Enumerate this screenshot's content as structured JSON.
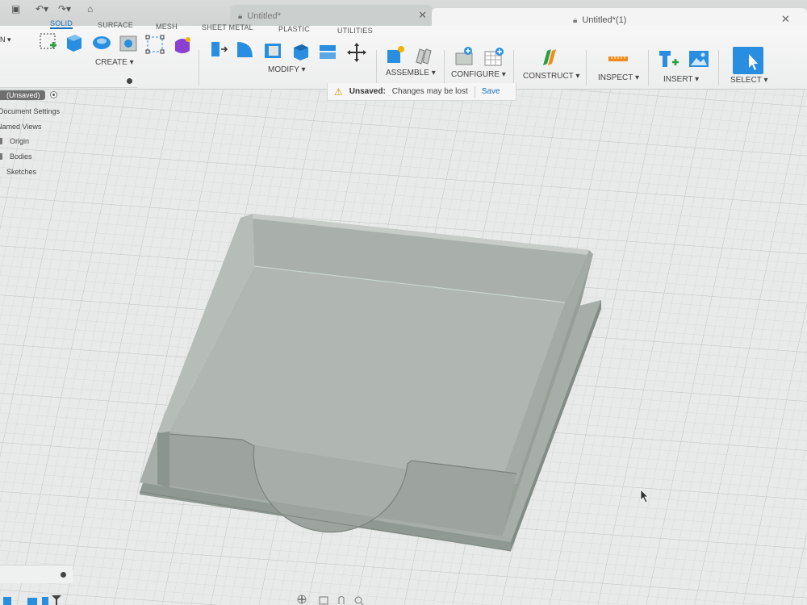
{
  "window": {
    "inactive_tab": {
      "title": "Untitled*"
    },
    "active_tab": {
      "title": "Untitled*(1)"
    }
  },
  "toolbar": {
    "workspace_dropdown": "N",
    "workspace_tabs": [
      "SOLID",
      "SURFACE",
      "MESH",
      "SHEET METAL",
      "PLASTIC",
      "UTILITIES"
    ],
    "active_tab": "SOLID",
    "groups": {
      "create": "CREATE",
      "modify": "MODIFY",
      "assemble": "ASSEMBLE",
      "configure": "CONFIGURE",
      "construct": "CONSTRUCT",
      "inspect": "INSPECT",
      "insert": "INSERT",
      "select": "SELECT"
    }
  },
  "notice": {
    "label": "Unsaved:",
    "message": "Changes may be lost",
    "save": "Save"
  },
  "browser": {
    "root": "(Unsaved)",
    "items": [
      "Document Settings",
      "Named Views",
      "Origin",
      "Bodies",
      "Sketches"
    ]
  },
  "colors": {
    "accent": "#1b6fc0",
    "select_button": "#2a8ee0",
    "warning": "#e08a00",
    "model_body": "#a3aba6",
    "grid_background": "#e6e8e7"
  }
}
